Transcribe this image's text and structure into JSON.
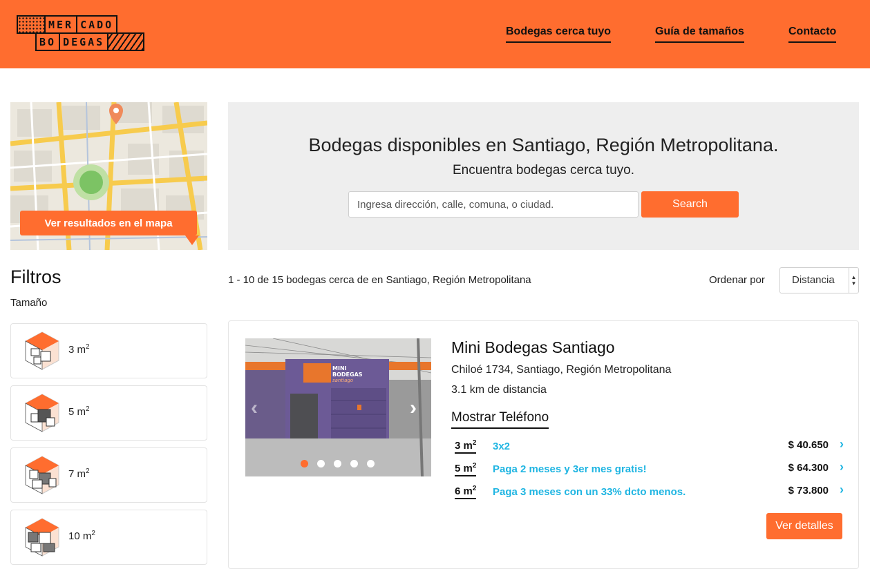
{
  "header": {
    "logo_top": [
      "MER",
      "CADO"
    ],
    "logo_bottom": [
      "BO",
      "DEGAS"
    ],
    "nav": [
      {
        "label": "Bodegas cerca tuyo"
      },
      {
        "label": "Guía de tamaños"
      },
      {
        "label": "Contacto"
      }
    ],
    "brand_color": "#ff6d2f"
  },
  "map": {
    "button_label": "Ver resultados en el mapa"
  },
  "search": {
    "title": "Bodegas disponibles en Santiago, Región Metropolitana.",
    "subtitle": "Encuentra bodegas cerca tuyo.",
    "placeholder": "Ingresa dirección, calle, comuna, o ciudad.",
    "value": "",
    "button_label": "Search"
  },
  "filters": {
    "title": "Filtros",
    "size_label": "Tamaño",
    "sizes": [
      {
        "value": "3 m",
        "sup": "2"
      },
      {
        "value": "5 m",
        "sup": "2"
      },
      {
        "value": "7 m",
        "sup": "2"
      },
      {
        "value": "10 m",
        "sup": "2"
      }
    ]
  },
  "results": {
    "count_text": "1 - 10 de 15 bodegas cerca de en Santiago, Región Metropolitana",
    "order_label": "Ordenar por",
    "order_value": "Distancia"
  },
  "listing": {
    "name": "Mini Bodegas Santiago",
    "address": "Chiloé 1734, Santiago, Región Metropolitana",
    "distance": "3.1 km de distancia",
    "show_phone": "Mostrar Teléfono",
    "photo_sign_1": "MINI",
    "photo_sign_2": "BODEGAS",
    "photo_sign_3": "santiago",
    "photo_count": 5,
    "active_photo": 1,
    "offers": [
      {
        "size": "3 m",
        "sup": "2",
        "promo": "3x2",
        "price": "$ 40.650"
      },
      {
        "size": "5 m",
        "sup": "2",
        "promo": "Paga 2 meses y 3er mes gratis!",
        "price": "$ 64.300"
      },
      {
        "size": "6 m",
        "sup": "2",
        "promo": "Paga 3 meses con un 33% dcto menos.",
        "price": "$ 73.800"
      }
    ],
    "details_label": "Ver detalles",
    "promo_color": "#1fb5e2"
  }
}
